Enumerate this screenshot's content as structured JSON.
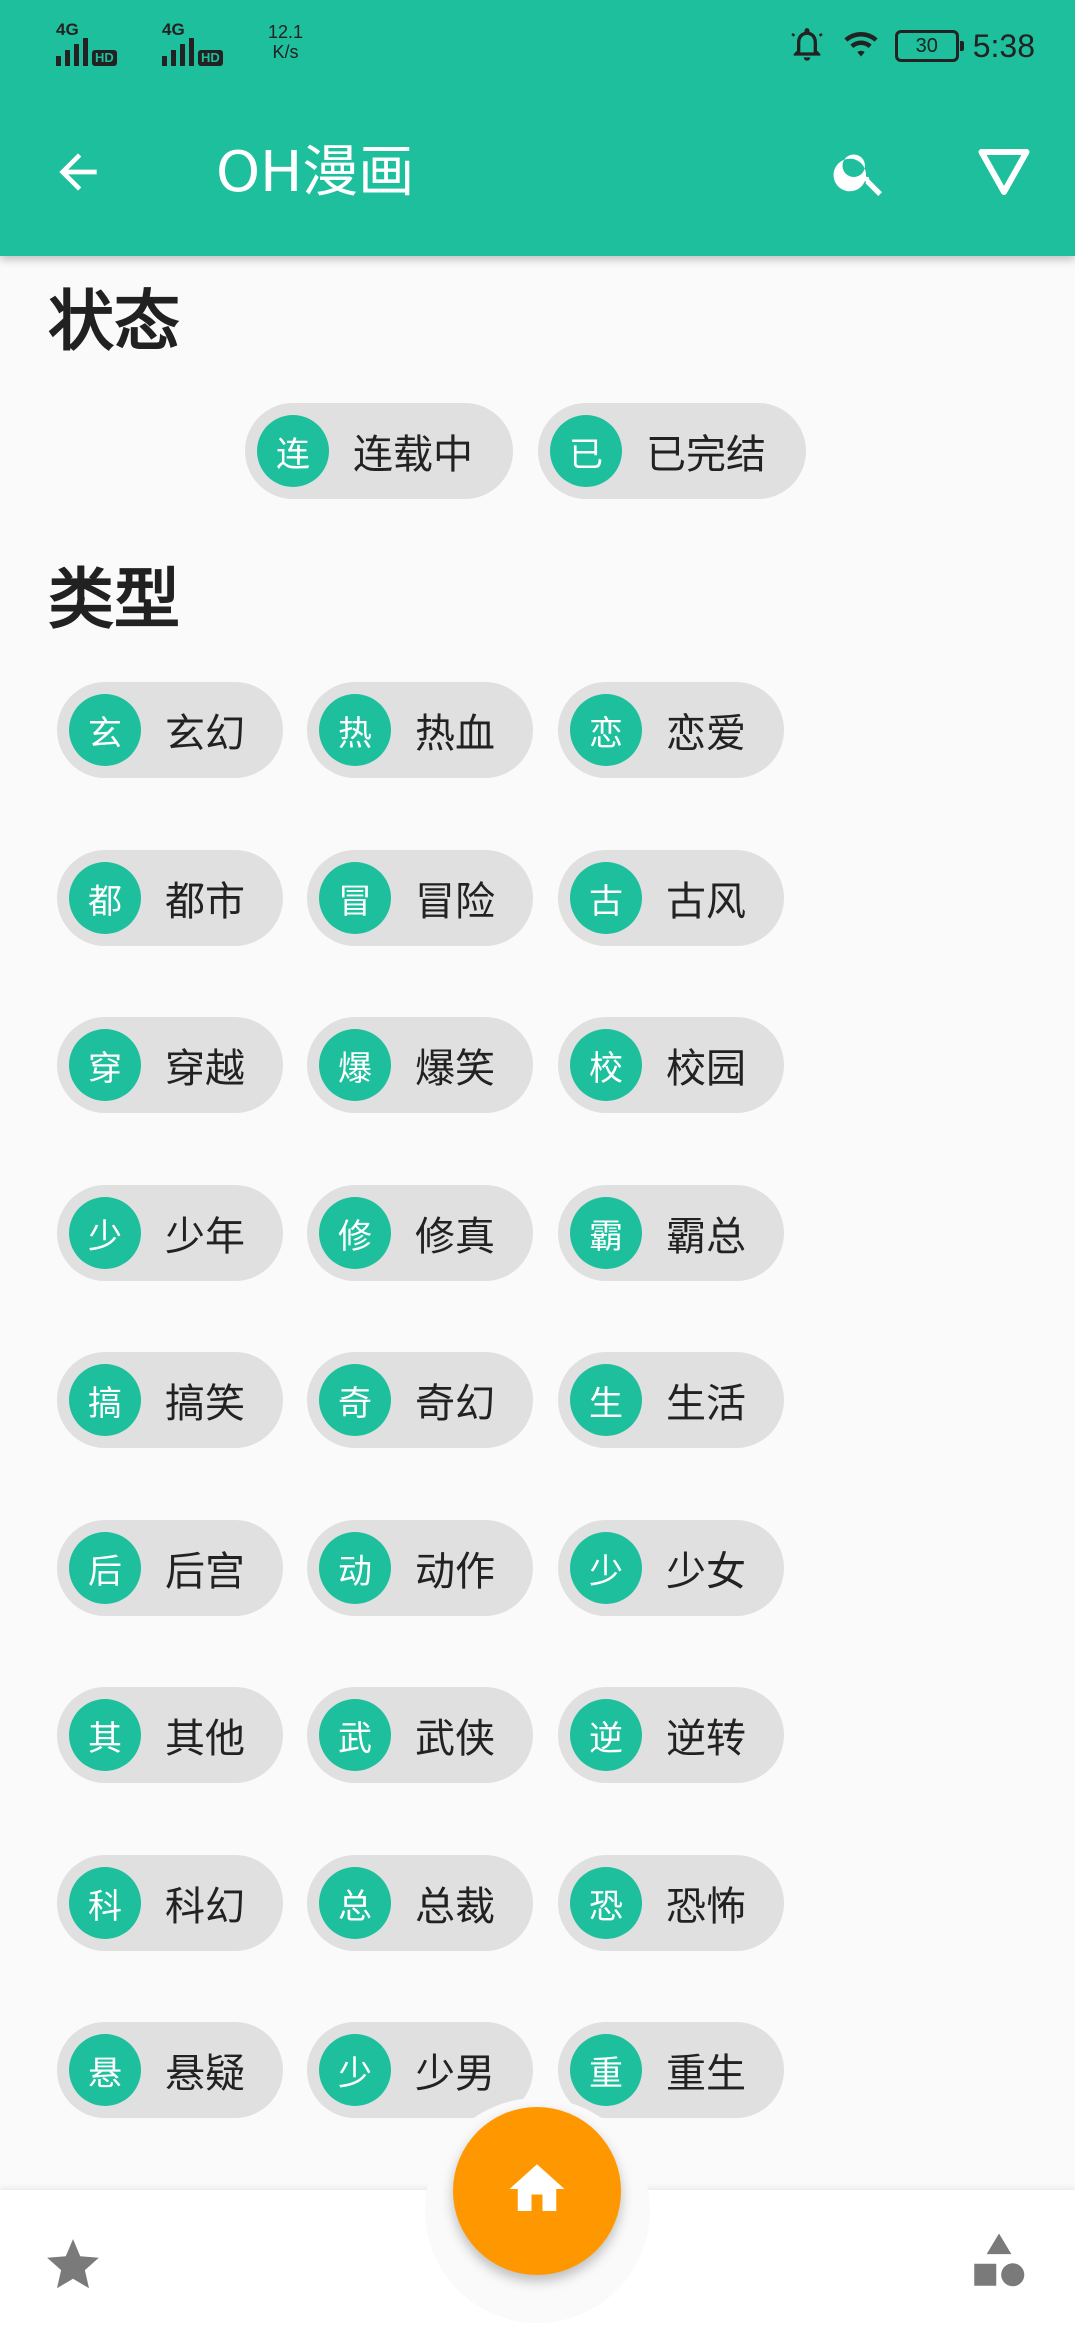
{
  "status_bar": {
    "sim1_label": "4G",
    "sim1_hd": "HD",
    "sim2_label": "4G",
    "sim2_hd": "HD",
    "speed_value": "12.1",
    "speed_unit": "K/s",
    "battery": "30",
    "time": "5:38"
  },
  "app_bar": {
    "title": "OH漫画",
    "back_icon": "arrow-back-icon",
    "search_icon": "search-icon",
    "filter_icon": "filter-triangle-icon"
  },
  "status_section": {
    "title": "状态",
    "chips": [
      {
        "avatar": "连",
        "label": "连载中"
      },
      {
        "avatar": "已",
        "label": "已完结"
      }
    ]
  },
  "genre_section": {
    "title": "类型",
    "chips": [
      {
        "avatar": "玄",
        "label": "玄幻"
      },
      {
        "avatar": "热",
        "label": "热血"
      },
      {
        "avatar": "恋",
        "label": "恋爱"
      },
      {
        "avatar": "都",
        "label": "都市"
      },
      {
        "avatar": "冒",
        "label": "冒险"
      },
      {
        "avatar": "古",
        "label": "古风"
      },
      {
        "avatar": "穿",
        "label": "穿越"
      },
      {
        "avatar": "爆",
        "label": "爆笑"
      },
      {
        "avatar": "校",
        "label": "校园"
      },
      {
        "avatar": "少",
        "label": "少年"
      },
      {
        "avatar": "修",
        "label": "修真"
      },
      {
        "avatar": "霸",
        "label": "霸总"
      },
      {
        "avatar": "搞",
        "label": "搞笑"
      },
      {
        "avatar": "奇",
        "label": "奇幻"
      },
      {
        "avatar": "生",
        "label": "生活"
      },
      {
        "avatar": "后",
        "label": "后宫"
      },
      {
        "avatar": "动",
        "label": "动作"
      },
      {
        "avatar": "少",
        "label": "少女"
      },
      {
        "avatar": "其",
        "label": "其他"
      },
      {
        "avatar": "武",
        "label": "武侠"
      },
      {
        "avatar": "逆",
        "label": "逆转"
      },
      {
        "avatar": "科",
        "label": "科幻"
      },
      {
        "avatar": "总",
        "label": "总裁"
      },
      {
        "avatar": "恐",
        "label": "恐怖"
      },
      {
        "avatar": "悬",
        "label": "悬疑"
      },
      {
        "avatar": "少",
        "label": "少男"
      },
      {
        "avatar": "重",
        "label": "重生"
      }
    ]
  },
  "bottom_bar": {
    "left_icon": "star-icon",
    "fab_icon": "home-icon",
    "right_icon": "shapes-icon"
  },
  "colors": {
    "primary": "#1dbf9d",
    "fab": "#ff9800",
    "chip_bg": "#e0e0e0"
  }
}
